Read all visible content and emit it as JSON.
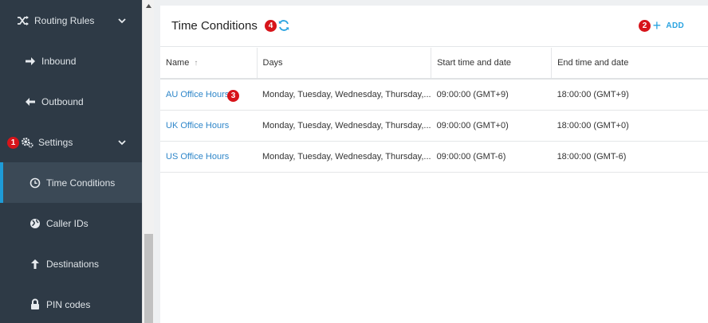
{
  "sidebar": {
    "items": [
      {
        "label": "Routing Rules",
        "icon": "shuffle-icon"
      },
      {
        "label": "Inbound",
        "icon": "arrow-right-icon"
      },
      {
        "label": "Outbound",
        "icon": "arrow-left-icon"
      },
      {
        "label": "Settings",
        "icon": "gears-icon"
      },
      {
        "label": "Time Conditions",
        "icon": "clock-icon"
      },
      {
        "label": "Caller IDs",
        "icon": "globe-icon"
      },
      {
        "label": "Destinations",
        "icon": "arrow-up-icon"
      },
      {
        "label": "PIN codes",
        "icon": "lock-icon"
      }
    ],
    "active_color": "#1e9bd7",
    "background": "#2e3a46"
  },
  "main": {
    "title": "Time Conditions",
    "add_label": "ADD",
    "accent": "#29a3e0",
    "table": {
      "columns": [
        "Name",
        "Days",
        "Start time and date",
        "End time and date"
      ],
      "sort_indicator": "↑",
      "rows": [
        {
          "name": "AU Office Hours",
          "days": "Monday, Tuesday, Wednesday, Thursday,...",
          "start": "09:00:00 (GMT+9)",
          "end": "18:00:00 (GMT+9)"
        },
        {
          "name": "UK Office Hours",
          "days": "Monday, Tuesday, Wednesday, Thursday,...",
          "start": "09:00:00 (GMT+0)",
          "end": "18:00:00 (GMT+0)"
        },
        {
          "name": "US Office Hours",
          "days": "Monday, Tuesday, Wednesday, Thursday,...",
          "start": "09:00:00 (GMT-6)",
          "end": "18:00:00 (GMT-6)"
        }
      ]
    }
  },
  "annotations": {
    "one": "1",
    "two": "2",
    "three": "3",
    "four": "4",
    "color": "#d7141a"
  }
}
